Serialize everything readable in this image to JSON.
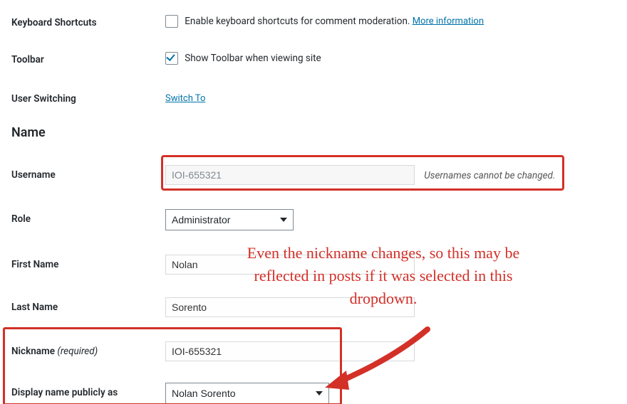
{
  "rows": {
    "keyboard_shortcuts": {
      "label": "Keyboard Shortcuts",
      "checkbox_text": "Enable keyboard shortcuts for comment moderation.",
      "more_info": "More information"
    },
    "toolbar": {
      "label": "Toolbar",
      "checkbox_text": "Show Toolbar when viewing site"
    },
    "user_switching": {
      "label": "User Switching",
      "link_text": "Switch To"
    }
  },
  "section_title": "Name",
  "username": {
    "label": "Username",
    "value": "IOI-655321",
    "note": "Usernames cannot be changed."
  },
  "role": {
    "label": "Role",
    "value": "Administrator"
  },
  "first_name": {
    "label": "First Name",
    "value": "Nolan"
  },
  "last_name": {
    "label": "Last Name",
    "value": "Sorento"
  },
  "nickname": {
    "label": "Nickname",
    "required": "(required)",
    "value": "IOI-655321"
  },
  "display_name": {
    "label": "Display name publicly as",
    "value": "Nolan Sorento"
  },
  "annotation": "Even the nickname changes, so this may be reflected in posts if it was selected in this dropdown."
}
